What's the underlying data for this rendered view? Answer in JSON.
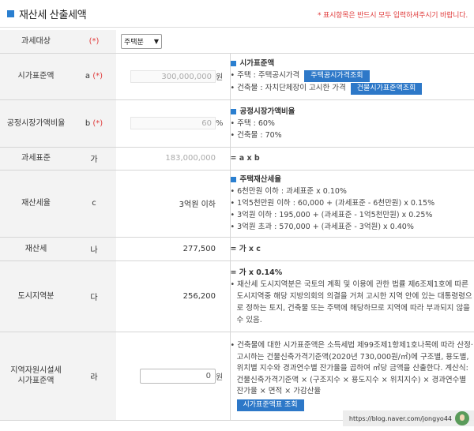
{
  "header": {
    "title": "재산세 산출세액",
    "notice": "* 표시항목은 반드시 모두 입력하셔주시기 바랍니다."
  },
  "rows": {
    "target": {
      "label": "과세대상",
      "symbol": "(*)",
      "select_value": "주택분"
    },
    "official_price": {
      "label": "시가표준액",
      "symbol_letter": "a",
      "symbol_req": "(*)",
      "value": "300,000,000",
      "unit": "원",
      "desc_title": "시가표준액",
      "desc_lines": [
        {
          "text": "주택 : 주택공시가격",
          "button": "주택공시가격조회"
        },
        {
          "text": "건축물 : 자치단체장이 고시한 가격",
          "button": "건물시가표준액조회"
        }
      ]
    },
    "fair_ratio": {
      "label": "공정시장가액비율",
      "symbol_letter": "b",
      "symbol_req": "(*)",
      "value": "60",
      "unit": "%",
      "desc_title": "공정시장가액비율",
      "desc_lines": [
        "주택 : 60%",
        "건축물 : 70%"
      ]
    },
    "tax_base": {
      "label": "과세표준",
      "symbol": "가",
      "value": "183,000,000",
      "formula": "= a x b"
    },
    "tax_rate": {
      "label": "재산세율",
      "symbol": "c",
      "value": "3억원 이하",
      "desc_title": "주택재산세율",
      "desc_lines": [
        "6천만원 이하      : 과세표준 x 0.10%",
        "1억5천만원 이하 : 60,000 + (과세표준 - 6천만원) x 0.15%",
        "3억원 이하        : 195,000 + (과세표준 - 1억5천만원) x 0.25%",
        "3억원 초과        : 570,000 + (과세표준 - 3억원) x 0.40%"
      ]
    },
    "property_tax": {
      "label": "재산세",
      "symbol": "나",
      "value": "277,500",
      "formula": "= 가 x c"
    },
    "urban_tax": {
      "label": "도시지역분",
      "symbol": "다",
      "value": "256,200",
      "formula": "= 가 x 0.14%",
      "desc": "재산세 도시지역분은 국토의 계획 및 이용에 관한 법률 제6조제1호에 따른 도시지역중 해당 지방의회의 의결을 거쳐 고시한 지역 안에 있는 대통령령으로 정하는 토지, 건축물 또는 주택에 해당하므로 지역에 따라 부과되지 않을 수 있음."
    },
    "facility_tax": {
      "label_line1": "지역자원시설세",
      "label_line2": "시가표준액",
      "symbol": "라",
      "value": "0",
      "unit": "원",
      "desc": "건축물에 대한 시가표준액은 소득세법 제99조제1항제1호나목에 따라 산정·고시하는 건물신축가격기준액(2020년 730,000원/㎡)에 구조별, 용도별, 위치별 지수와 경과연수별 잔가율을 곱하여 ㎡당 금액을 산출한다. 계산식: 건물신축가격기준액 × (구조지수 × 용도지수 × 위치지수) × 경과연수별 잔가율 × 면적 × 가감산율",
      "button": "시가표준액표 조회"
    }
  },
  "watermark": "https://blog.naver.com/jongyo44"
}
